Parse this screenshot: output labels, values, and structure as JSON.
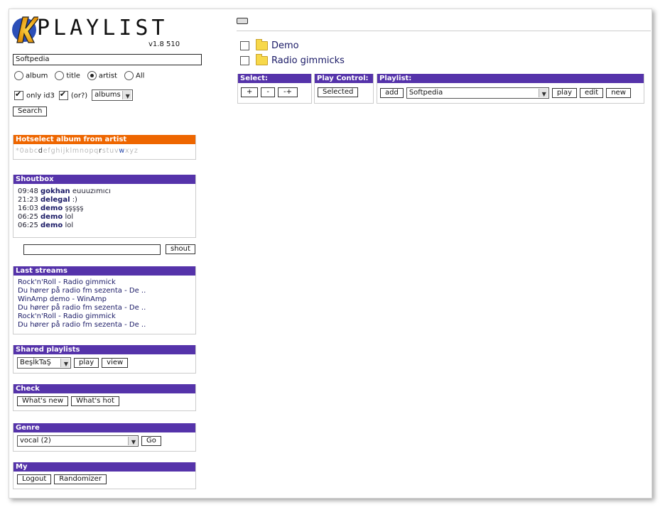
{
  "logo": {
    "text": "PLAYLIST",
    "version": "v1.8 510"
  },
  "search": {
    "value": "Softpedia",
    "options": [
      "album",
      "title",
      "artist",
      "All"
    ],
    "selected": "artist",
    "only_id3_label": "only id3",
    "or_label": "(or?)",
    "type_select": "albums",
    "button": "Search"
  },
  "hotselect": {
    "title": "Hotselect album from artist",
    "letters": [
      "*",
      "0",
      "a",
      "b",
      "c",
      "d",
      "e",
      "f",
      "g",
      "h",
      "i",
      "j",
      "k",
      "l",
      "m",
      "n",
      "o",
      "p",
      "q",
      "r",
      "s",
      "t",
      "u",
      "v",
      "w",
      "x",
      "y",
      "z"
    ],
    "active": [
      "d",
      "r",
      "w"
    ]
  },
  "shoutbox": {
    "title": "Shoutbox",
    "messages": [
      {
        "time": "09:48",
        "user": "gokhan",
        "text": "euuuzımıcı"
      },
      {
        "time": "21:23",
        "user": "delegal",
        "text": ":)"
      },
      {
        "time": "16:03",
        "user": "demo",
        "text": "şşşşş"
      },
      {
        "time": "06:25",
        "user": "demo",
        "text": "lol"
      },
      {
        "time": "06:25",
        "user": "demo",
        "text": "lol"
      }
    ],
    "button": "shout"
  },
  "streams": {
    "title": "Last streams",
    "items": [
      "Rock'n'Roll - Radio gimmick",
      "Du hører på radio fm sezenta - De ..",
      "WinAmp demo - WinAmp",
      "Du hører på radio fm sezenta - De ..",
      "Rock'n'Roll - Radio gimmick",
      "Du hører på radio fm sezenta - De .."
    ]
  },
  "shared": {
    "title": "Shared playlists",
    "selected": "BeşİkTaŞ",
    "play": "play",
    "view": "view"
  },
  "check": {
    "title": "Check",
    "new": "What's new",
    "hot": "What's hot"
  },
  "genre": {
    "title": "Genre",
    "selected": "vocal (2)",
    "go": "Go"
  },
  "my": {
    "title": "My",
    "logout": "Logout",
    "randomizer": "Randomizer"
  },
  "folders": [
    "Demo",
    "Radio gimmicks"
  ],
  "controls": {
    "select_title": "Select:",
    "select_btns": [
      "+",
      "-",
      "-+"
    ],
    "play_title": "Play Control:",
    "play_btn": "Selected",
    "playlist_title": "Playlist:",
    "add": "add",
    "playlist_selected": "Softpedia",
    "play": "play",
    "edit": "edit",
    "new": "new"
  },
  "colors": {
    "header": "#5533aa",
    "hotselect": "#ee6600",
    "link": "#1a1a66"
  }
}
